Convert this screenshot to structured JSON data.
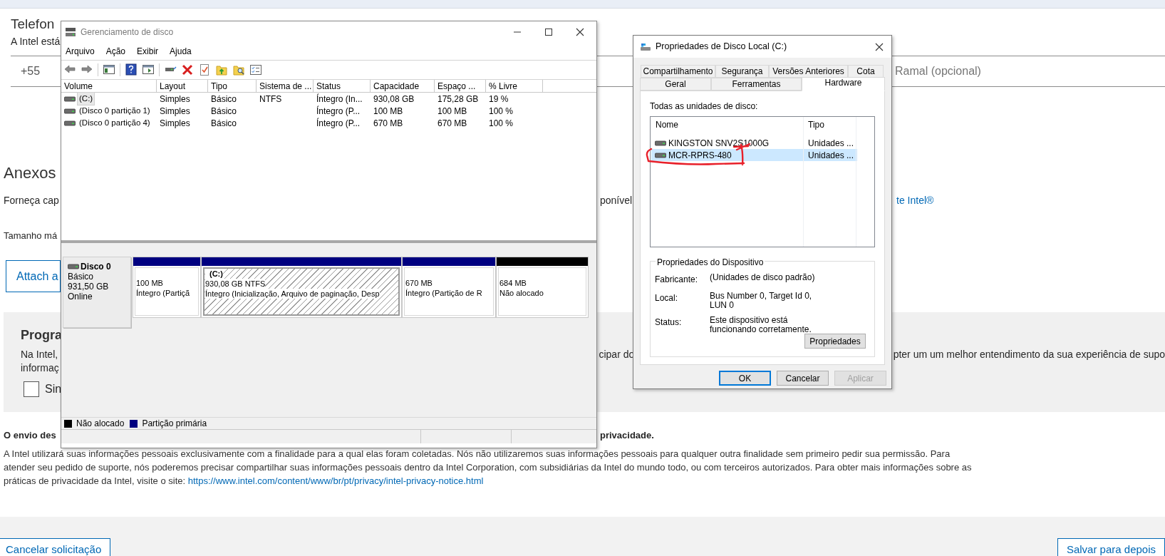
{
  "web_page": {
    "phone_section": {
      "heading": "Telefon",
      "description": "A Intel está",
      "country_code": "+55",
      "extension_placeholder": "Ramal (opcional)"
    },
    "attachments": {
      "heading": "Anexos",
      "description_start": "Forneça cap",
      "description_middle": "ponível",
      "link_end": "te Intel®",
      "size_note": "Tamanho má",
      "attach_button": "Attach a"
    },
    "program_section": {
      "heading": "Progra",
      "line1_start": "Na Intel,",
      "line1_middle": "cipar do",
      "line1_end": "pter um um melhor entendimento da sua experiência de supo",
      "line2_start": "informaç",
      "checkbox": {
        "label": "Sin",
        "checked": false
      }
    },
    "privacy": {
      "notice_start": "O envio des",
      "notice_end": "privacidade.",
      "paragraph": "A Intel utilizará suas informações pessoais exclusivamente com a finalidade para a qual elas foram coletadas. Nós não utilizaremos suas informações pessoais para qualquer outra finalidade sem primeiro pedir sua permissão. Para atender seu pedido de suporte, nós poderemos precisar compartilhar suas informações pessoais dentro da Intel Corporation, com subsidiárias da Intel do mundo todo, ou com terceiros autorizados. Para obter mais informações sobre as práticas de privacidade da Intel, visite o site:",
      "link": "https://www.intel.com/content/www/br/pt/privacy/intel-privacy-notice.html"
    },
    "footer_buttons": [
      "Cancelar solicitação",
      "Salvar para depois"
    ]
  },
  "disk_management": {
    "title": "Gerenciamento de disco",
    "menu": [
      "Arquivo",
      "Ação",
      "Exibir",
      "Ajuda"
    ],
    "columns": [
      "Volume",
      "Layout",
      "Tipo",
      "Sistema de ...",
      "Status",
      "Capacidade",
      "Espaço ...",
      "% Livre"
    ],
    "volumes": [
      {
        "cells": [
          "(C:)",
          "Simples",
          "Básico",
          "NTFS",
          "Íntegro (In...",
          "930,08 GB",
          "175,28 GB",
          "19 %"
        ],
        "selected": true
      },
      {
        "cells": [
          "(Disco 0 partição 1)",
          "Simples",
          "Básico",
          "",
          "Íntegro (P...",
          "100 MB",
          "100 MB",
          "100 %"
        ],
        "selected": false
      },
      {
        "cells": [
          "(Disco 0 partição 4)",
          "Simples",
          "Básico",
          "",
          "Íntegro (P...",
          "670 MB",
          "670 MB",
          "100 %"
        ],
        "selected": false
      }
    ],
    "disks": [
      {
        "name": "Disco 0",
        "type": "Básico",
        "size": "931,50 GB",
        "status": "Online",
        "partitions": [
          {
            "kind": "primary",
            "lines": [
              "100 MB",
              "Íntegro (Partiçã"
            ],
            "selected": false
          },
          {
            "kind": "primary",
            "label": "(C:)",
            "lines": [
              "930,08 GB NTFS",
              "Íntegro (Inicialização, Arquivo de paginação, Desp"
            ],
            "selected": true
          },
          {
            "kind": "primary",
            "lines": [
              "670 MB",
              "Íntegro (Partição de R"
            ],
            "selected": false
          },
          {
            "kind": "unallocated",
            "lines": [
              "684 MB",
              "Não alocado"
            ],
            "selected": false
          }
        ]
      }
    ],
    "legend": [
      {
        "kind": "unallocated",
        "label": "Não alocado"
      },
      {
        "kind": "primary",
        "label": "Partição primária"
      }
    ]
  },
  "properties_dialog": {
    "title": "Propriedades de Disco Local (C:)",
    "tab_rows": [
      [
        {
          "label": "Compartilhamento",
          "selected": false
        },
        {
          "label": "Segurança",
          "selected": false
        },
        {
          "label": "Versões Anteriores",
          "selected": false
        },
        {
          "label": "Cota",
          "selected": false
        }
      ],
      [
        {
          "label": "Geral",
          "selected": false
        },
        {
          "label": "Ferramentas",
          "selected": false
        },
        {
          "label": "Hardware",
          "selected": true
        }
      ]
    ],
    "list_label": "Todas as unidades de disco:",
    "list_columns": [
      "Nome",
      "Tipo"
    ],
    "drives": [
      {
        "name": "KINGSTON SNV2S1000G",
        "type": "Unidades ...",
        "selected": false
      },
      {
        "name": "MCR-RPRS-480",
        "type": "Unidades ...",
        "selected": true
      }
    ],
    "device_properties": {
      "title": "Propriedades do Dispositivo",
      "fields": [
        {
          "label": "Fabricante:",
          "value": "(Unidades de disco padrão)"
        },
        {
          "label": "Local:",
          "value": "Bus Number 0, Target Id 0, LUN 0"
        },
        {
          "label": "Status:",
          "value": "Este dispositivo está funcionando corretamente."
        }
      ],
      "button": "Propriedades"
    },
    "buttons": [
      {
        "label": "OK",
        "default": true,
        "disabled": false
      },
      {
        "label": "Cancelar",
        "default": false,
        "disabled": false
      },
      {
        "label": "Aplicar",
        "default": false,
        "disabled": true
      }
    ]
  }
}
